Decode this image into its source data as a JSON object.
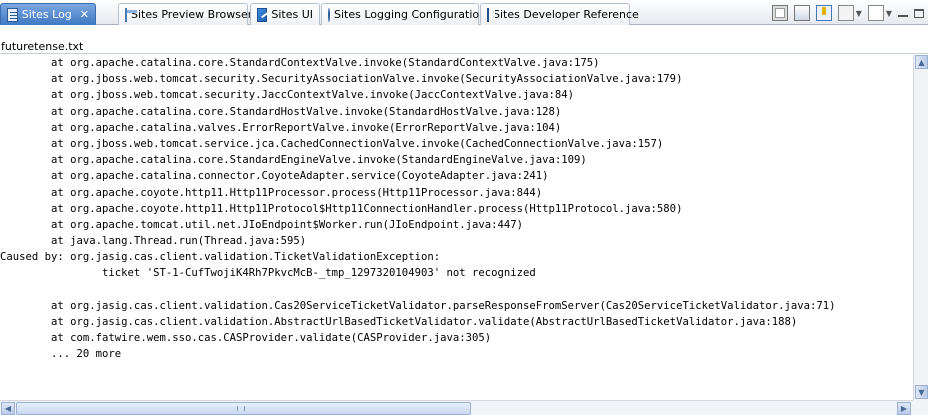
{
  "tabs": [
    {
      "label": "Sites Log",
      "icon": "log-icon",
      "active": true,
      "closable": true
    },
    {
      "label": "Sites Preview Browser",
      "icon": "browser-icon"
    },
    {
      "label": "Sites UI",
      "icon": "sites-ui-icon"
    },
    {
      "label": "Sites Logging Configuration",
      "icon": "config-icon"
    },
    {
      "label": "Sites Developer Reference",
      "icon": "reference-icon"
    }
  ],
  "tab_close_glyph": "✕",
  "toolbar_icons": [
    "clear-console-icon",
    "scroll-lock-icon",
    "pin-console-icon",
    "display-console-icon",
    "new-console-icon",
    "minimize-icon",
    "maximize-icon"
  ],
  "file_name": "futuretense.txt",
  "console": {
    "lines": [
      "        at org.apache.catalina.core.StandardContextValve.invoke(StandardContextValve.java:175)",
      "        at org.jboss.web.tomcat.security.SecurityAssociationValve.invoke(SecurityAssociationValve.java:179)",
      "        at org.jboss.web.tomcat.security.JaccContextValve.invoke(JaccContextValve.java:84)",
      "        at org.apache.catalina.core.StandardHostValve.invoke(StandardHostValve.java:128)",
      "        at org.apache.catalina.valves.ErrorReportValve.invoke(ErrorReportValve.java:104)",
      "        at org.jboss.web.tomcat.service.jca.CachedConnectionValve.invoke(CachedConnectionValve.java:157)",
      "        at org.apache.catalina.core.StandardEngineValve.invoke(StandardEngineValve.java:109)",
      "        at org.apache.catalina.connector.CoyoteAdapter.service(CoyoteAdapter.java:241)",
      "        at org.apache.coyote.http11.Http11Processor.process(Http11Processor.java:844)",
      "        at org.apache.coyote.http11.Http11Protocol$Http11ConnectionHandler.process(Http11Protocol.java:580)",
      "        at org.apache.tomcat.util.net.JIoEndpoint$Worker.run(JIoEndpoint.java:447)",
      "        at java.lang.Thread.run(Thread.java:595)",
      "Caused by: org.jasig.cas.client.validation.TicketValidationException:",
      "                ticket 'ST-1-CufTwojiK4Rh7PkvcMcB-_tmp_1297320104903' not recognized",
      "",
      "        at org.jasig.cas.client.validation.Cas20ServiceTicketValidator.parseResponseFromServer(Cas20ServiceTicketValidator.java:71)",
      "        at org.jasig.cas.client.validation.AbstractUrlBasedTicketValidator.validate(AbstractUrlBasedTicketValidator.java:188)",
      "        at com.fatwire.wem.sso.cas.CASProvider.validate(CASProvider.java:305)",
      "        ... 20 more"
    ]
  },
  "scrollbars": {
    "up_arrow": "▲",
    "down_arrow": "▼",
    "left_arrow": "◀",
    "right_arrow": "▶"
  }
}
